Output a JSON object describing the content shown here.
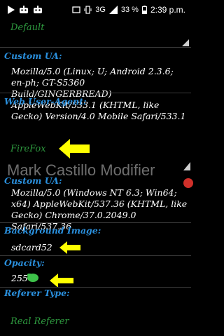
{
  "status_bar": {
    "network": "3G",
    "battery": "33 %",
    "time": "2:39 p.m.",
    "icons": [
      "play-icon",
      "robot-icon",
      "robot-icon",
      "cast-icon",
      "vibrate-icon",
      "signal-icon",
      "battery-icon"
    ]
  },
  "items": {
    "default_value": "Default",
    "custom_ua_header_1": "Custom UA:",
    "custom_ua_value_1": "Mozilla/5.0 (Linux; U; Android 2.3.6; en-ph; GT-S5360 Build/GINGERBREAD) AppleWebKit/533.1 (KHTML, like Gecko) Version/4.0 Mobile Safari/533.1",
    "web_user_agent_header": "Web User-Agent:",
    "web_user_agent_value": "FireFox",
    "watermark": "Mark Castillo Modifier",
    "custom_ua_header_2": "Custom UA:",
    "custom_ua_value_2": "Mozilla/5.0 (Windows NT 6.3; Win64; x64) AppleWebKit/537.36 (KHTML, like Gecko) Chrome/37.0.2049.0 Safari/537.36",
    "background_image_header": "Background Image:",
    "background_image_value": "sdcard52",
    "opacity_header": "Opacity:",
    "opacity_value": "255",
    "referer_type_header": "Referer Type:",
    "referer_type_value": "Real Referer"
  },
  "colors": {
    "header_blue": "#2a8fdc",
    "value_green": "#2e9a3f",
    "arrow_yellow": "#ffff00",
    "background": "#000000"
  }
}
